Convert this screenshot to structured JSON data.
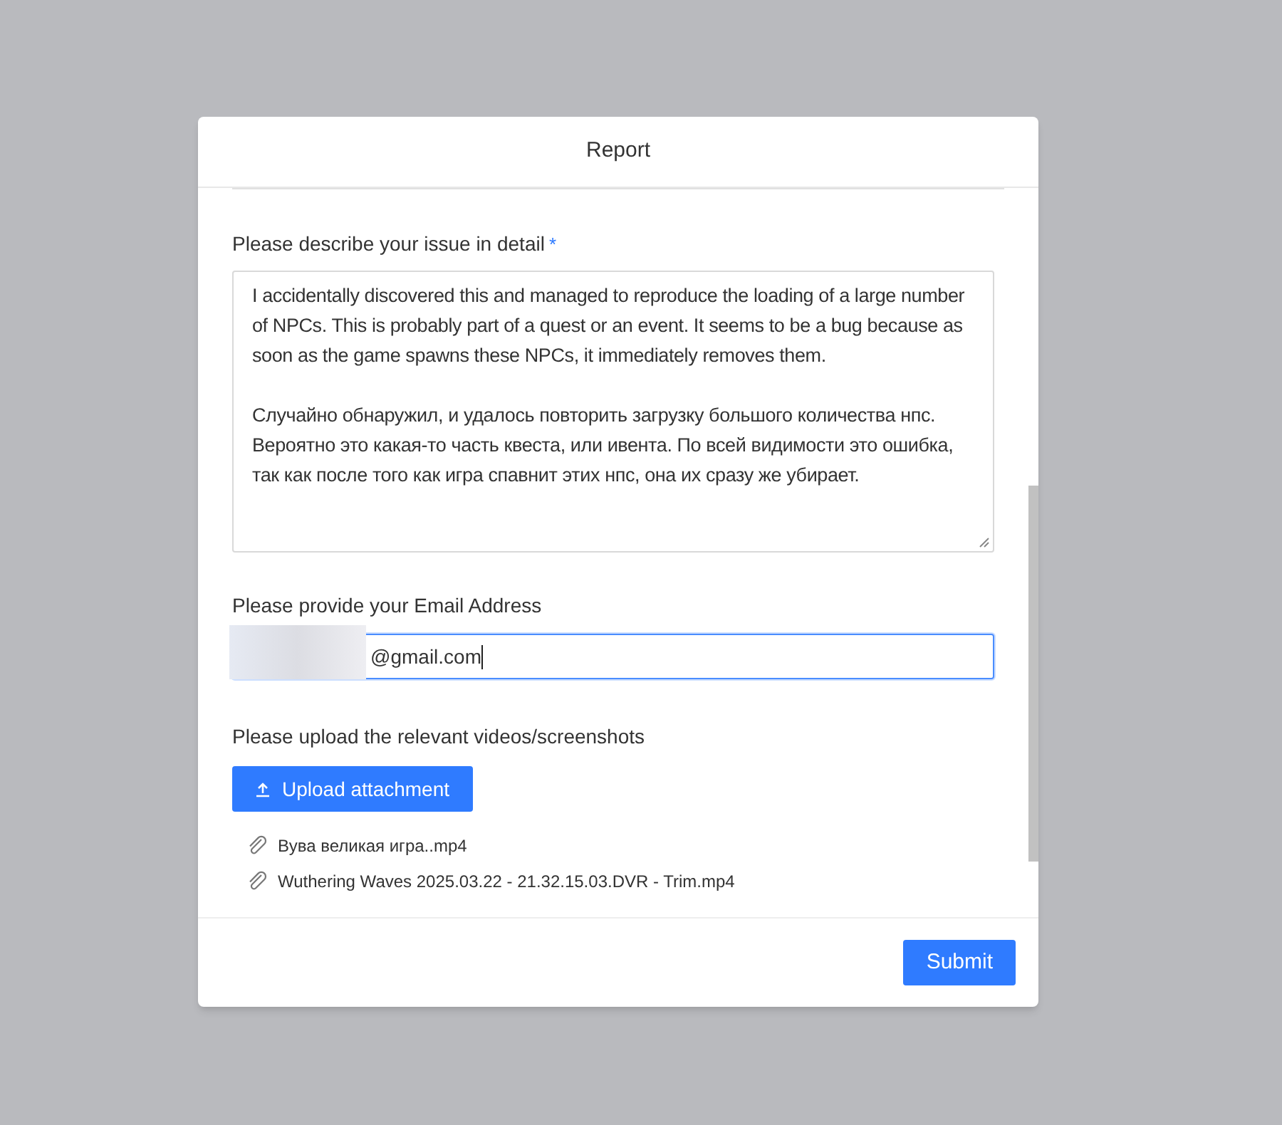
{
  "dialog": {
    "title": "Report"
  },
  "description": {
    "label": "Please describe your issue in detail",
    "required_mark": "*",
    "value": "I accidentally discovered this and managed to reproduce the loading of a large number of NPCs. This is probably part of a quest or an event. It seems to be a bug because as soon as the game spawns these NPCs, it immediately removes them.\n\nСлучайно обнаружил, и удалось повторить загрузку большого количества нпс. Вероятно это какая-то часть квеста, или ивента. По всей видимости это ошибка, так как после того как игра спавнит этих нпс, она их сразу же убирает."
  },
  "email": {
    "label": "Please provide your Email Address",
    "value": "@gmail.com",
    "focused": true
  },
  "upload": {
    "label": "Please upload the relevant videos/screenshots",
    "button": "Upload attachment",
    "files": [
      {
        "name": "Вува великая игра..mp4"
      },
      {
        "name": "Wuthering Waves 2025.03.22 - 21.32.15.03.DVR - Trim.mp4"
      }
    ]
  },
  "footer": {
    "submit": "Submit"
  }
}
